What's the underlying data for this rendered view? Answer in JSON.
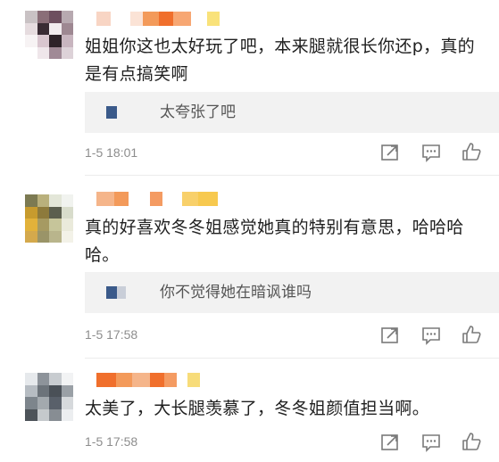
{
  "comments": [
    {
      "text": "姐姐你这也太好玩了吧，本来腿就很长你还p，真的是有点搞笑啊",
      "reply": "太夸张了吧",
      "time": "1-5 18:01"
    },
    {
      "text": "真的好喜欢冬冬姐感觉她真的特别有意思，哈哈哈哈。",
      "reply": "你不觉得她在暗讽谁吗",
      "time": "1-5 17:58"
    },
    {
      "text": "太美了，大长腿羡慕了，冬冬姐颜值担当啊。",
      "time": "1-5 17:58"
    }
  ],
  "icons": {
    "share": "share-icon",
    "comment": "comment-icon",
    "like": "thumbs-up-icon"
  },
  "colors": {
    "text": "#1f1f1f",
    "meta": "#8d8d8d",
    "reply_bg": "#f2f2f2",
    "icon": "#7a7a7a"
  }
}
